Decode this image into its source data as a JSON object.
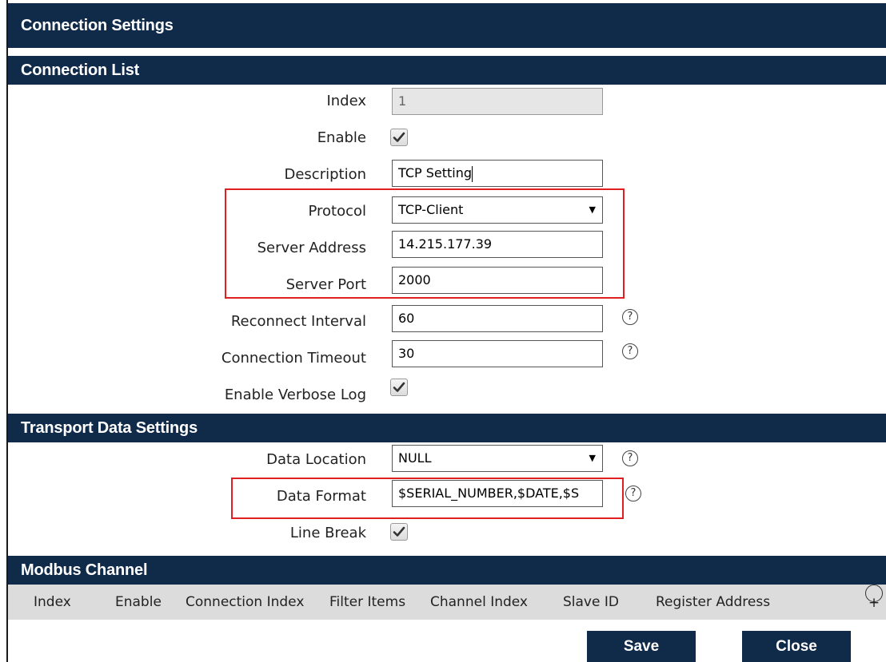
{
  "header": {
    "title": "Connection Settings"
  },
  "connection_list": {
    "section_title": "Connection List",
    "index": {
      "label": "Index",
      "value": "1"
    },
    "enable": {
      "label": "Enable",
      "checked": true
    },
    "description": {
      "label": "Description",
      "value": "TCP Setting"
    },
    "protocol": {
      "label": "Protocol",
      "value": "TCP-Client"
    },
    "server_address": {
      "label": "Server Address",
      "value": "14.215.177.39"
    },
    "server_port": {
      "label": "Server Port",
      "value": "2000"
    },
    "reconnect_interval": {
      "label": "Reconnect Interval",
      "value": "60"
    },
    "connection_timeout": {
      "label": "Connection Timeout",
      "value": "30"
    },
    "verbose_log": {
      "label": "Enable Verbose Log",
      "checked": true
    }
  },
  "transport": {
    "section_title": "Transport Data Settings",
    "data_location": {
      "label": "Data Location",
      "value": "NULL"
    },
    "data_format": {
      "label": "Data Format",
      "value": "$SERIAL_NUMBER,$DATE,$S"
    },
    "line_break": {
      "label": "Line Break",
      "checked": true
    }
  },
  "modbus": {
    "section_title": "Modbus Channel",
    "columns": [
      "Index",
      "Enable",
      "Connection Index",
      "Filter Items",
      "Channel Index",
      "Slave ID",
      "Register Address"
    ]
  },
  "buttons": {
    "save": "Save",
    "close": "Close"
  },
  "icons": {
    "help": "help-circle-icon",
    "add": "add-circle-icon",
    "check": "checkmark-icon",
    "dropdown": "caret-down-icon"
  },
  "colors": {
    "header_bg": "#102a4a",
    "highlight": "#e02020",
    "table_header_bg": "#dcdcdc"
  }
}
